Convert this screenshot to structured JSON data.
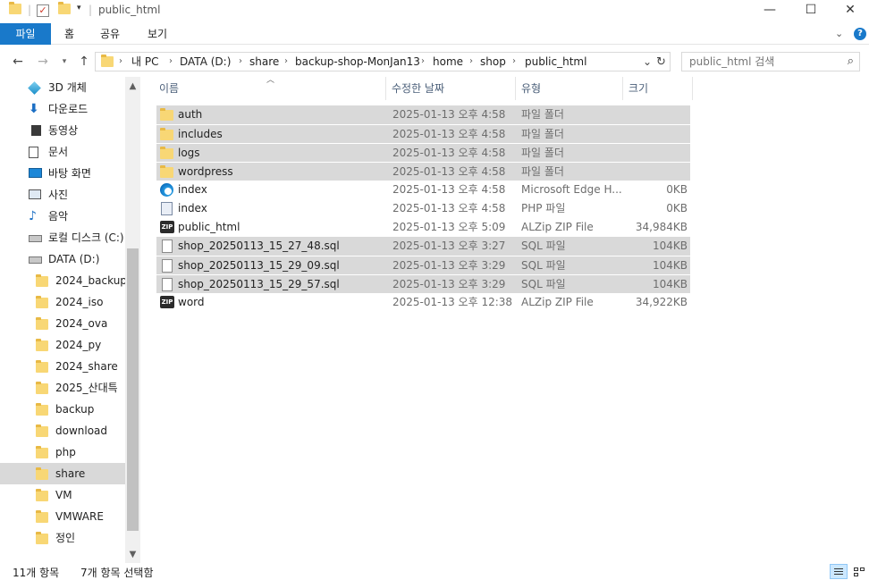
{
  "window": {
    "title": "public_html",
    "controls": {
      "minimize": "—",
      "maximize": "☐",
      "close": "✕"
    }
  },
  "ribbon": {
    "tabs": [
      "파일",
      "홈",
      "공유",
      "보기"
    ],
    "collapse_icon": "chevron-down-icon",
    "help_icon": "help-icon"
  },
  "address": {
    "crumbs": [
      "내 PC",
      "DATA (D:)",
      "share",
      "backup-shop-MonJan13",
      "home",
      "shop",
      "public_html"
    ]
  },
  "search": {
    "placeholder": "public_html 검색"
  },
  "sidebar": {
    "items": [
      {
        "label": "3D 개체",
        "icon": "3d-objects-icon"
      },
      {
        "label": "다운로드",
        "icon": "download-icon"
      },
      {
        "label": "동영상",
        "icon": "video-icon"
      },
      {
        "label": "문서",
        "icon": "document-icon"
      },
      {
        "label": "바탕 화면",
        "icon": "desktop-icon"
      },
      {
        "label": "사진",
        "icon": "pictures-icon"
      },
      {
        "label": "음악",
        "icon": "music-icon"
      },
      {
        "label": "로컬 디스크 (C:)",
        "icon": "drive-icon"
      },
      {
        "label": "DATA (D:)",
        "icon": "drive-icon"
      },
      {
        "label": "2024_backup",
        "icon": "folder-icon"
      },
      {
        "label": "2024_iso",
        "icon": "folder-icon"
      },
      {
        "label": "2024_ova",
        "icon": "folder-icon"
      },
      {
        "label": "2024_py",
        "icon": "folder-icon"
      },
      {
        "label": "2024_share",
        "icon": "folder-icon"
      },
      {
        "label": "2025_산대특",
        "icon": "folder-icon"
      },
      {
        "label": "backup",
        "icon": "folder-icon"
      },
      {
        "label": "download",
        "icon": "folder-icon"
      },
      {
        "label": "php",
        "icon": "folder-icon"
      },
      {
        "label": "share",
        "icon": "folder-icon",
        "selected": true
      },
      {
        "label": "VM",
        "icon": "folder-icon"
      },
      {
        "label": "VMWARE",
        "icon": "folder-icon"
      },
      {
        "label": "정인",
        "icon": "folder-icon"
      }
    ]
  },
  "columns": {
    "name": "이름",
    "date": "수정한 날짜",
    "type": "유형",
    "size": "크기"
  },
  "files": [
    {
      "name": "auth",
      "date": "2025-01-13 오후 4:58",
      "type": "파일 폴더",
      "size": "",
      "icon": "folder-icon",
      "selected": true
    },
    {
      "name": "includes",
      "date": "2025-01-13 오후 4:58",
      "type": "파일 폴더",
      "size": "",
      "icon": "folder-icon",
      "selected": true
    },
    {
      "name": "logs",
      "date": "2025-01-13 오후 4:58",
      "type": "파일 폴더",
      "size": "",
      "icon": "folder-icon",
      "selected": true
    },
    {
      "name": "wordpress",
      "date": "2025-01-13 오후 4:58",
      "type": "파일 폴더",
      "size": "",
      "icon": "folder-icon",
      "selected": true
    },
    {
      "name": "index",
      "date": "2025-01-13 오후 4:58",
      "type": "Microsoft Edge H...",
      "size": "0KB",
      "icon": "edge-html-icon",
      "selected": false
    },
    {
      "name": "index",
      "date": "2025-01-13 오후 4:58",
      "type": "PHP 파일",
      "size": "0KB",
      "icon": "php-file-icon",
      "selected": false
    },
    {
      "name": "public_html",
      "date": "2025-01-13 오후 5:09",
      "type": "ALZip ZIP File",
      "size": "34,984KB",
      "icon": "zip-icon",
      "selected": false
    },
    {
      "name": "shop_20250113_15_27_48.sql",
      "date": "2025-01-13 오후 3:27",
      "type": "SQL 파일",
      "size": "104KB",
      "icon": "sql-file-icon",
      "selected": true
    },
    {
      "name": "shop_20250113_15_29_09.sql",
      "date": "2025-01-13 오후 3:29",
      "type": "SQL 파일",
      "size": "104KB",
      "icon": "sql-file-icon",
      "selected": true
    },
    {
      "name": "shop_20250113_15_29_57.sql",
      "date": "2025-01-13 오후 3:29",
      "type": "SQL 파일",
      "size": "104KB",
      "icon": "sql-file-icon",
      "selected": true
    },
    {
      "name": "word",
      "date": "2025-01-13 오후 12:38",
      "type": "ALZip ZIP File",
      "size": "34,922KB",
      "icon": "zip-icon",
      "selected": false
    }
  ],
  "status": {
    "count": "11개 항목",
    "selected": "7개 항목 선택함"
  },
  "colors": {
    "accent": "#1979ca",
    "selection": "#d9d9d9",
    "folder": "#f8d775"
  }
}
